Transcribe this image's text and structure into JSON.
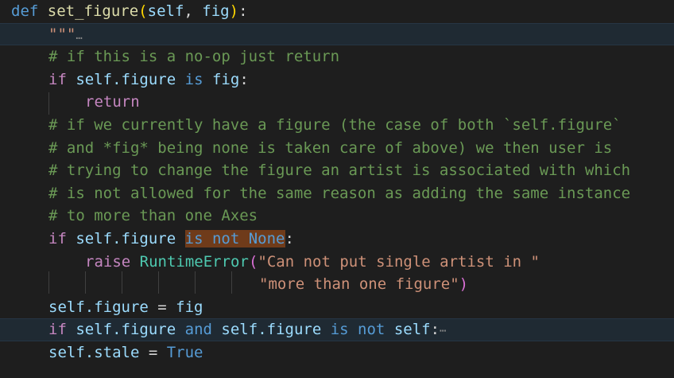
{
  "editor": {
    "language": "python",
    "theme_colors": {
      "background": "#1e1e1e",
      "keyword": "#569cd6",
      "control_keyword": "#c586c0",
      "function": "#dcdcaa",
      "parameter": "#9cdcfe",
      "class": "#4ec9b0",
      "string": "#ce9178",
      "comment": "#6a9955",
      "selection_highlight": "#6f3b1a",
      "folded_line": "#1f2a33"
    },
    "lines": {
      "l1": {
        "def": "def",
        "name": "set_figure",
        "open": "(",
        "self": "self",
        "comma": ", ",
        "fig": "fig",
        "close": ")",
        "colon": ":"
      },
      "l2": {
        "docstring": "\"\"\"",
        "fold_marker": "…"
      },
      "l3": {
        "comment": "# if this is a no-op just return"
      },
      "l4": {
        "if": "if",
        "expr_self": "self",
        "dot_figure": ".figure",
        "is": "is",
        "fig": "fig",
        "colon": ":"
      },
      "l5": {
        "return": "return"
      },
      "l6": {
        "comment": "# if we currently have a figure (the case of both `self.figure`"
      },
      "l7": {
        "comment": "# and *fig* being none is taken care of above) we then user is"
      },
      "l8": {
        "comment": "# trying to change the figure an artist is associated with which"
      },
      "l9": {
        "comment": "# is not allowed for the same reason as adding the same instance"
      },
      "l10": {
        "comment": "# to more than one Axes"
      },
      "l11": {
        "if": "if",
        "expr_self": "self",
        "dot_figure": ".figure",
        "is_not": "is not",
        "none": "None",
        "colon": ":"
      },
      "l12": {
        "raise": "raise",
        "exc": "RuntimeError",
        "open": "(",
        "str": "\"Can not put single artist in \""
      },
      "l13": {
        "str": "\"more than one figure\"",
        "close": ")"
      },
      "l14": {
        "self": "self",
        "dot_figure": ".figure",
        "eq": " = ",
        "fig": "fig"
      },
      "l15": {
        "if": "if",
        "self1": "self",
        "dot_figure1": ".figure",
        "and": "and",
        "self2": "self",
        "dot_figure2": ".figure",
        "is_not": "is not",
        "self3": "self",
        "colon": ":",
        "fold_marker": "⋯"
      },
      "l16": {
        "self": "self",
        "dot_stale": ".stale",
        "eq": " = ",
        "true": "True"
      }
    }
  }
}
